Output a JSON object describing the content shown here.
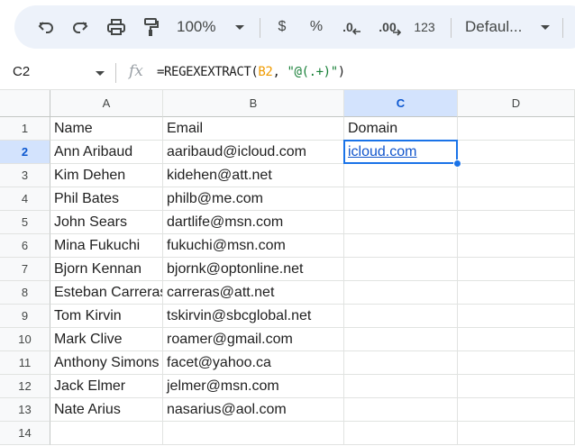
{
  "toolbar": {
    "zoom": "100%",
    "currency_label": "$",
    "percent_label": "%",
    "decrease_decimal_label": ".0",
    "increase_decimal_label": ".00",
    "number_format_label": "123",
    "font_label": "Defaul..."
  },
  "formula_bar": {
    "cell_ref": "C2",
    "fx_label": "fx",
    "formula_prefix": "=REGEXEXTRACT(",
    "formula_ref": "B2",
    "formula_sep": ", ",
    "formula_string": "\"@(.+)\"",
    "formula_suffix": ")"
  },
  "sheet": {
    "columns": [
      "A",
      "B",
      "C",
      "D"
    ],
    "selected_column": "C",
    "selected_row": "2",
    "rows": [
      {
        "num": "1",
        "cells": [
          "Name",
          "Email",
          "Domain",
          ""
        ]
      },
      {
        "num": "2",
        "cells": [
          "Ann Aribaud",
          "aaribaud@icloud.com",
          "icloud.com",
          ""
        ]
      },
      {
        "num": "3",
        "cells": [
          "Kim Dehen",
          "kidehen@att.net",
          "",
          ""
        ]
      },
      {
        "num": "4",
        "cells": [
          "Phil Bates",
          "philb@me.com",
          "",
          ""
        ]
      },
      {
        "num": "5",
        "cells": [
          "John Sears",
          "dartlife@msn.com",
          "",
          ""
        ]
      },
      {
        "num": "6",
        "cells": [
          "Mina Fukuchi",
          "fukuchi@msn.com",
          "",
          ""
        ]
      },
      {
        "num": "7",
        "cells": [
          "Bjorn Kennan",
          "bjornk@optonline.net",
          "",
          ""
        ]
      },
      {
        "num": "8",
        "cells": [
          "Esteban Carreras",
          "carreras@att.net",
          "",
          ""
        ]
      },
      {
        "num": "9",
        "cells": [
          "Tom Kirvin",
          "tskirvin@sbcglobal.net",
          "",
          ""
        ]
      },
      {
        "num": "10",
        "cells": [
          "Mark Clive",
          "roamer@gmail.com",
          "",
          ""
        ]
      },
      {
        "num": "11",
        "cells": [
          "Anthony Simons",
          "facet@yahoo.ca",
          "",
          ""
        ]
      },
      {
        "num": "12",
        "cells": [
          "Jack Elmer",
          "jelmer@msn.com",
          "",
          ""
        ]
      },
      {
        "num": "13",
        "cells": [
          "Nate Arius",
          "nasarius@aol.com",
          "",
          ""
        ]
      },
      {
        "num": "14",
        "cells": [
          "",
          "",
          "",
          ""
        ]
      }
    ]
  }
}
